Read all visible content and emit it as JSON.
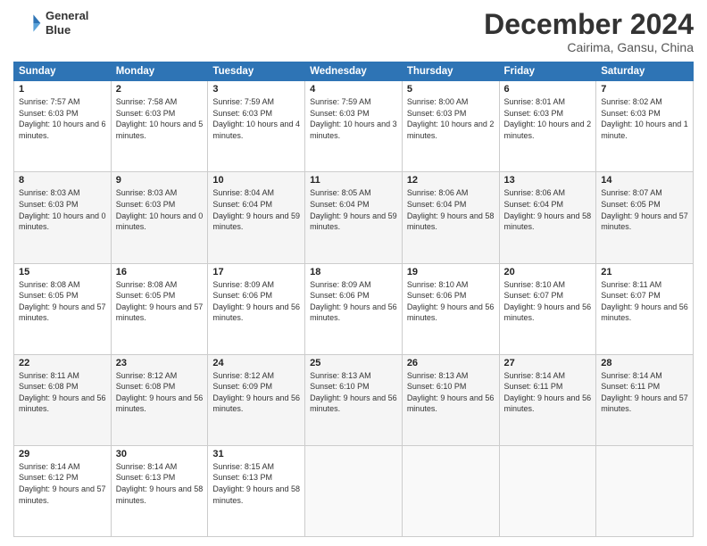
{
  "header": {
    "logo_line1": "General",
    "logo_line2": "Blue",
    "month": "December 2024",
    "location": "Cairima, Gansu, China"
  },
  "weekdays": [
    "Sunday",
    "Monday",
    "Tuesday",
    "Wednesday",
    "Thursday",
    "Friday",
    "Saturday"
  ],
  "weeks": [
    [
      {
        "day": "1",
        "sunrise": "7:57 AM",
        "sunset": "6:03 PM",
        "daylight": "10 hours and 6 minutes."
      },
      {
        "day": "2",
        "sunrise": "7:58 AM",
        "sunset": "6:03 PM",
        "daylight": "10 hours and 5 minutes."
      },
      {
        "day": "3",
        "sunrise": "7:59 AM",
        "sunset": "6:03 PM",
        "daylight": "10 hours and 4 minutes."
      },
      {
        "day": "4",
        "sunrise": "7:59 AM",
        "sunset": "6:03 PM",
        "daylight": "10 hours and 3 minutes."
      },
      {
        "day": "5",
        "sunrise": "8:00 AM",
        "sunset": "6:03 PM",
        "daylight": "10 hours and 2 minutes."
      },
      {
        "day": "6",
        "sunrise": "8:01 AM",
        "sunset": "6:03 PM",
        "daylight": "10 hours and 2 minutes."
      },
      {
        "day": "7",
        "sunrise": "8:02 AM",
        "sunset": "6:03 PM",
        "daylight": "10 hours and 1 minute."
      }
    ],
    [
      {
        "day": "8",
        "sunrise": "8:03 AM",
        "sunset": "6:03 PM",
        "daylight": "10 hours and 0 minutes."
      },
      {
        "day": "9",
        "sunrise": "8:03 AM",
        "sunset": "6:03 PM",
        "daylight": "10 hours and 0 minutes."
      },
      {
        "day": "10",
        "sunrise": "8:04 AM",
        "sunset": "6:04 PM",
        "daylight": "9 hours and 59 minutes."
      },
      {
        "day": "11",
        "sunrise": "8:05 AM",
        "sunset": "6:04 PM",
        "daylight": "9 hours and 59 minutes."
      },
      {
        "day": "12",
        "sunrise": "8:06 AM",
        "sunset": "6:04 PM",
        "daylight": "9 hours and 58 minutes."
      },
      {
        "day": "13",
        "sunrise": "8:06 AM",
        "sunset": "6:04 PM",
        "daylight": "9 hours and 58 minutes."
      },
      {
        "day": "14",
        "sunrise": "8:07 AM",
        "sunset": "6:05 PM",
        "daylight": "9 hours and 57 minutes."
      }
    ],
    [
      {
        "day": "15",
        "sunrise": "8:08 AM",
        "sunset": "6:05 PM",
        "daylight": "9 hours and 57 minutes."
      },
      {
        "day": "16",
        "sunrise": "8:08 AM",
        "sunset": "6:05 PM",
        "daylight": "9 hours and 57 minutes."
      },
      {
        "day": "17",
        "sunrise": "8:09 AM",
        "sunset": "6:06 PM",
        "daylight": "9 hours and 56 minutes."
      },
      {
        "day": "18",
        "sunrise": "8:09 AM",
        "sunset": "6:06 PM",
        "daylight": "9 hours and 56 minutes."
      },
      {
        "day": "19",
        "sunrise": "8:10 AM",
        "sunset": "6:06 PM",
        "daylight": "9 hours and 56 minutes."
      },
      {
        "day": "20",
        "sunrise": "8:10 AM",
        "sunset": "6:07 PM",
        "daylight": "9 hours and 56 minutes."
      },
      {
        "day": "21",
        "sunrise": "8:11 AM",
        "sunset": "6:07 PM",
        "daylight": "9 hours and 56 minutes."
      }
    ],
    [
      {
        "day": "22",
        "sunrise": "8:11 AM",
        "sunset": "6:08 PM",
        "daylight": "9 hours and 56 minutes."
      },
      {
        "day": "23",
        "sunrise": "8:12 AM",
        "sunset": "6:08 PM",
        "daylight": "9 hours and 56 minutes."
      },
      {
        "day": "24",
        "sunrise": "8:12 AM",
        "sunset": "6:09 PM",
        "daylight": "9 hours and 56 minutes."
      },
      {
        "day": "25",
        "sunrise": "8:13 AM",
        "sunset": "6:10 PM",
        "daylight": "9 hours and 56 minutes."
      },
      {
        "day": "26",
        "sunrise": "8:13 AM",
        "sunset": "6:10 PM",
        "daylight": "9 hours and 56 minutes."
      },
      {
        "day": "27",
        "sunrise": "8:14 AM",
        "sunset": "6:11 PM",
        "daylight": "9 hours and 56 minutes."
      },
      {
        "day": "28",
        "sunrise": "8:14 AM",
        "sunset": "6:11 PM",
        "daylight": "9 hours and 57 minutes."
      }
    ],
    [
      {
        "day": "29",
        "sunrise": "8:14 AM",
        "sunset": "6:12 PM",
        "daylight": "9 hours and 57 minutes."
      },
      {
        "day": "30",
        "sunrise": "8:14 AM",
        "sunset": "6:13 PM",
        "daylight": "9 hours and 58 minutes."
      },
      {
        "day": "31",
        "sunrise": "8:15 AM",
        "sunset": "6:13 PM",
        "daylight": "9 hours and 58 minutes."
      },
      null,
      null,
      null,
      null
    ]
  ]
}
